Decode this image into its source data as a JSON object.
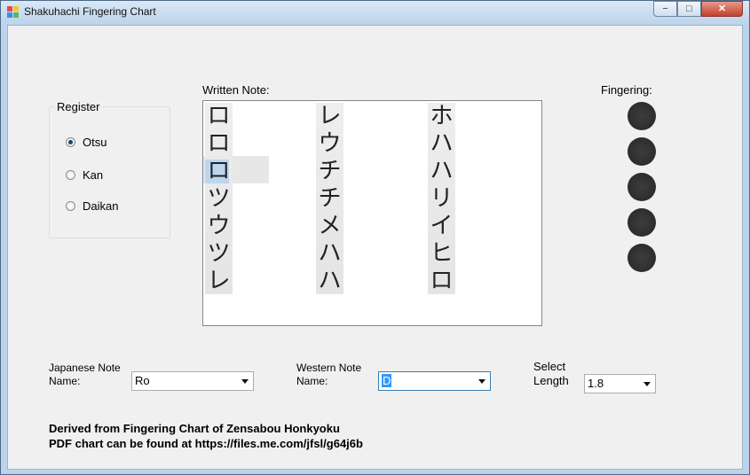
{
  "window": {
    "title": "Shakuhachi Fingering Chart",
    "controls": {
      "minimize": "−",
      "maximize": "□",
      "close": "✕"
    }
  },
  "register": {
    "label": "Register",
    "options": [
      {
        "label": "Otsu",
        "selected": true
      },
      {
        "label": "Kan",
        "selected": false
      },
      {
        "label": "Daikan",
        "selected": false
      }
    ]
  },
  "written_note": {
    "label": "Written Note:",
    "columns": [
      [
        "ロ",
        "ロ",
        "ロ",
        "ツ",
        "ウ",
        "ツ",
        "レ"
      ],
      [
        "レ",
        "ウ",
        "チ",
        "チ",
        "メ",
        "ハ",
        "ハ"
      ],
      [
        "ホ",
        "ハ",
        "ハ",
        "リ",
        "イ",
        "ヒ",
        "ロ"
      ]
    ],
    "selected_index": 2
  },
  "fingering": {
    "label": "Fingering:",
    "holes": [
      "closed",
      "closed",
      "closed",
      "closed",
      "closed"
    ]
  },
  "japanese_note": {
    "label_line1": "Japanese Note",
    "label_line2": "Name:",
    "value": "Ro"
  },
  "western_note": {
    "label_line1": "Western Note",
    "label_line2": "Name:",
    "value": "D"
  },
  "length": {
    "label_line1": "Select",
    "label_line2": "Length",
    "value": "1.8"
  },
  "footer": {
    "line1": "Derived from Fingering Chart of Zensabou Honkyoku",
    "line2": "PDF chart can be found at https://files.me.com/jfsl/g64j6b"
  }
}
